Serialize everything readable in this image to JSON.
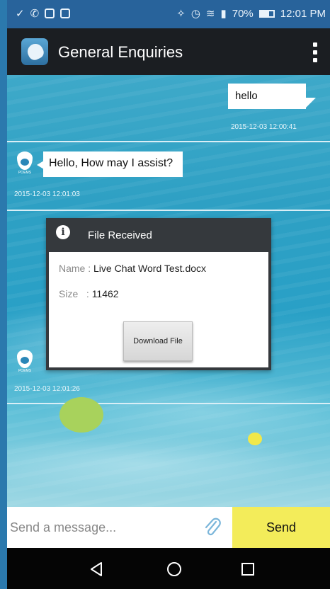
{
  "status_bar": {
    "battery": "70%",
    "battery_level": 0.7,
    "time": "12:01 PM"
  },
  "header": {
    "title": "General Enquiries"
  },
  "messages": {
    "outgoing": {
      "text": "hello",
      "timestamp": "2015-12-03 12:00:41"
    },
    "incoming": {
      "text": "Hello, How may I assist?",
      "timestamp": "2015-12-03 12:01:03"
    },
    "file": {
      "title": "File Received",
      "name_label": "Name : ",
      "name_value": "Live Chat Word Test.docx",
      "size_label": "Size   : ",
      "size_value": "11462",
      "download_label": "Download File",
      "timestamp": "2015-12-03 12:01:26"
    }
  },
  "composer": {
    "placeholder": "Send a message...",
    "send_label": "Send"
  },
  "colors": {
    "status_bar": "#28639b",
    "title_bar": "#1b1e22",
    "send_button": "#f3ec5a",
    "dialog_header": "#35393d"
  }
}
